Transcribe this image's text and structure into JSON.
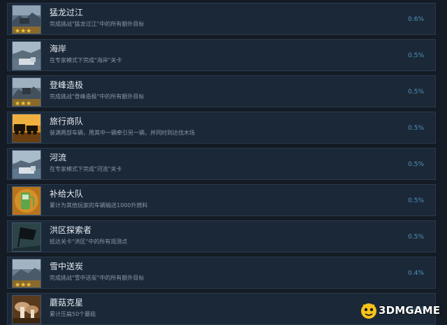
{
  "achievements": [
    {
      "title": "猛龙过江",
      "desc": "完成挑战\"猛龙过江\"中的所有额外目标",
      "pct": "0.6%",
      "icon": "challenge-stars-icon"
    },
    {
      "title": "海岸",
      "desc": "在专家模式下完成\"海岸\"关卡",
      "pct": "0.5%",
      "icon": "coast-truck-icon"
    },
    {
      "title": "登峰造极",
      "desc": "完成挑战\"登峰造极\"中的所有额外目标",
      "pct": "0.5%",
      "icon": "challenge-stars-icon"
    },
    {
      "title": "旅行商队",
      "desc": "装满两部车辆，用其中一辆牵引另一辆，并同时到达伐木场",
      "pct": "0.5%",
      "icon": "caravan-icon"
    },
    {
      "title": "河流",
      "desc": "在专家模式下完成\"河流\"关卡",
      "pct": "0.5%",
      "icon": "river-truck-icon"
    },
    {
      "title": "补给大队",
      "desc": "累计为其他玩家的车辆输送1000升燃料",
      "pct": "0.5%",
      "icon": "fuel-pump-icon"
    },
    {
      "title": "洪区探索者",
      "desc": "抵达关卡\"洪区\"中的所有观测点",
      "pct": "0.5%",
      "icon": "flag-icon"
    },
    {
      "title": "雪中送炭",
      "desc": "完成挑战\"雪中送炭\"中的所有额外目标",
      "pct": "0.4%",
      "icon": "challenge-stars-icon"
    },
    {
      "title": "蘑菇克星",
      "desc": "累计压扁50个蘑菇",
      "pct": "0.4%",
      "icon": "mushroom-icon"
    }
  ],
  "watermark": {
    "text": "3DMGAME"
  }
}
